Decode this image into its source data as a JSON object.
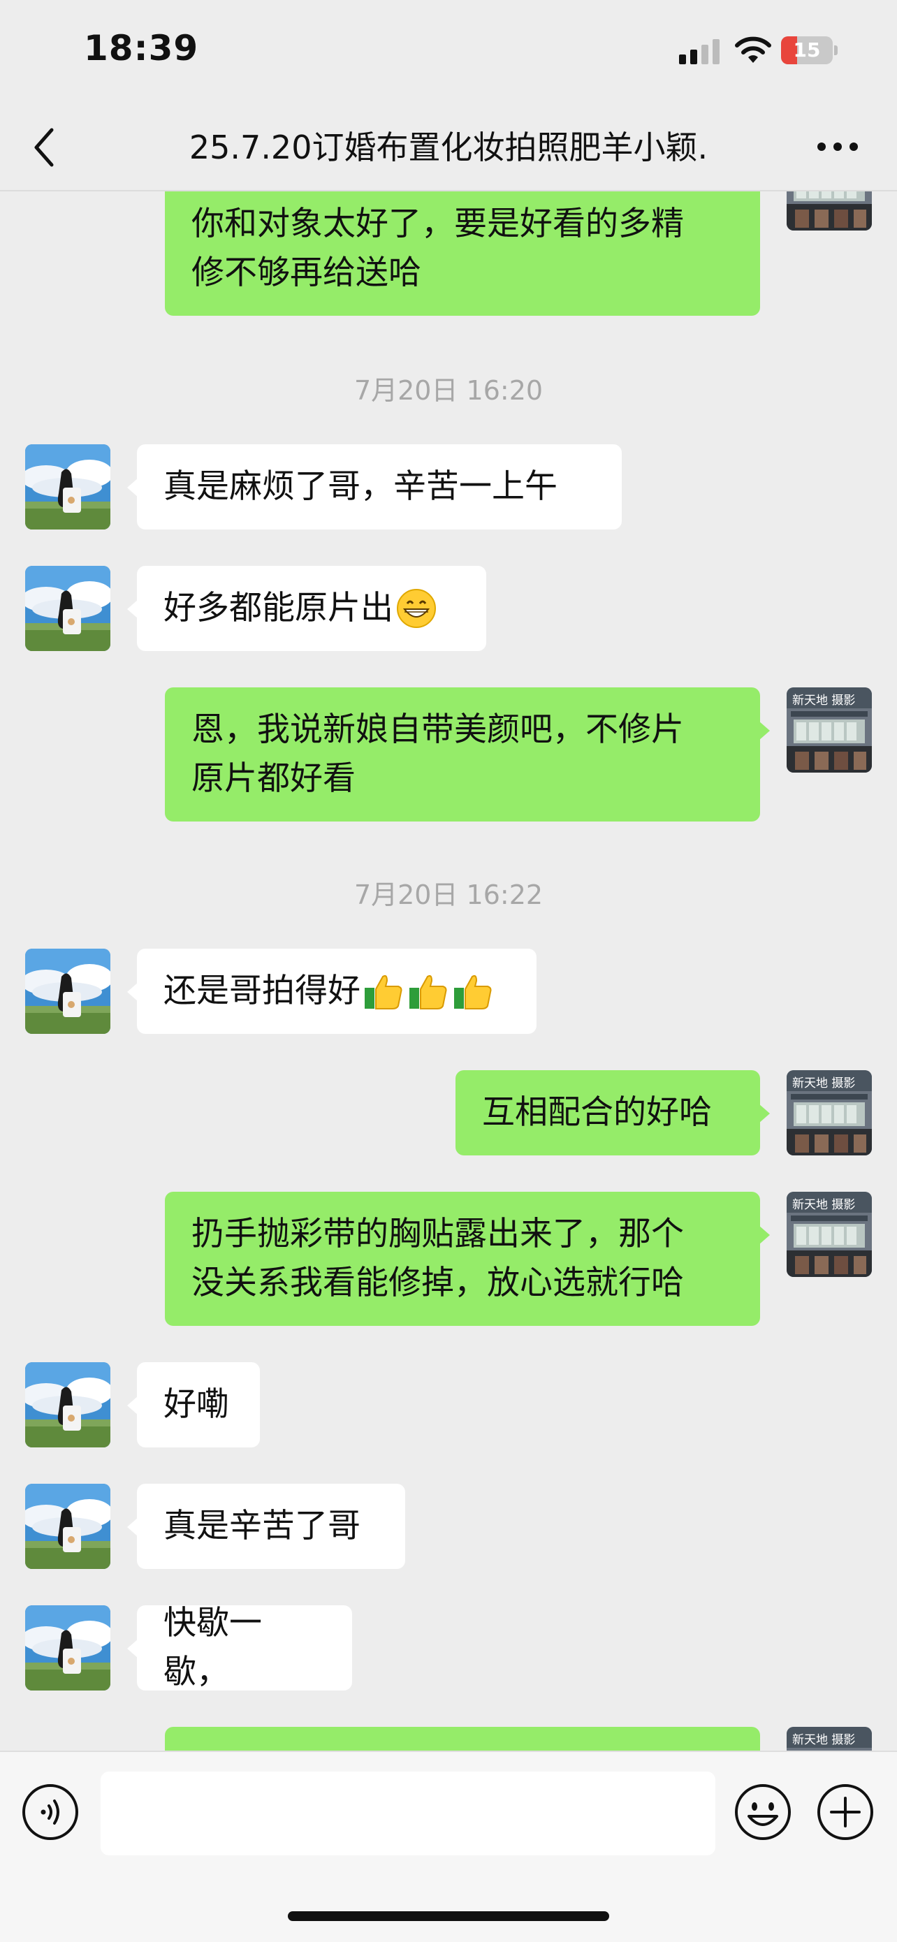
{
  "status_bar": {
    "time": "18:39",
    "battery_level": "15",
    "battery_fraction": 0.15,
    "icons": [
      "signal-icon",
      "wifi-icon",
      "battery-charging-icon"
    ]
  },
  "nav": {
    "title": "25.7.20订婚布置化妆拍照肥羊小颖.",
    "back_icon": "chevron-left-icon",
    "more_icon": "more-dots-icon"
  },
  "messages": {
    "m0": "你和对象太好了，要是好看的多精\n修不够再给送哈",
    "t1": "7月20日 16:20",
    "m1": "真是麻烦了哥，辛苦一上午",
    "m2": "好多都能原片出",
    "m3": "恩，我说新娘自带美颜吧，不修片\n原片都好看",
    "t2": "7月20日 16:22",
    "m4": "还是哥拍得好",
    "m5": "互相配合的好哈",
    "m6": "扔手抛彩带的胸贴露出来了，那个\n没关系我看能修掉，放心选就行哈",
    "m7": "好嘞",
    "m8": "真是辛苦了哥",
    "m9": "快歇一歇，"
  },
  "input_bar": {
    "placeholder": "",
    "icons": [
      "voice-icon",
      "emoji-icon",
      "plus-icon"
    ]
  },
  "colors": {
    "background": "#ededed",
    "outgoing_bubble": "#95ec69",
    "incoming_bubble": "#ffffff",
    "timestamp": "#a7a7a7"
  }
}
